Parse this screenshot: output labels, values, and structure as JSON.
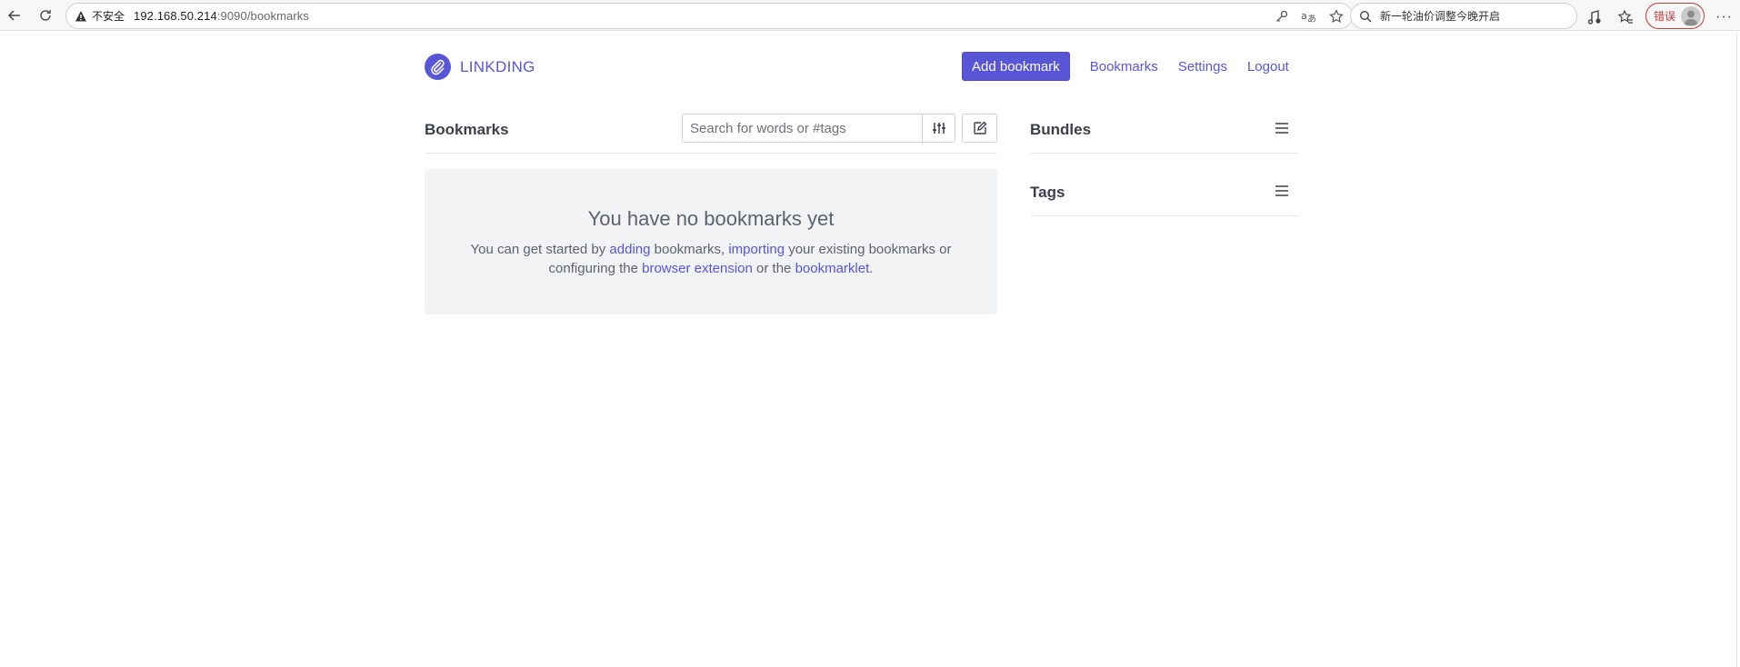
{
  "browser": {
    "insecure_label": "不安全",
    "url_host": "192.168.50.214",
    "url_rest": ":9090/bookmarks",
    "search_text": "新一轮油价调整今晚开启",
    "error_label": "错误",
    "more_label": "···"
  },
  "app": {
    "brand_name": "LINKDING",
    "nav": {
      "add_bookmark": "Add bookmark",
      "bookmarks": "Bookmarks",
      "settings": "Settings",
      "logout": "Logout"
    }
  },
  "main": {
    "title": "Bookmarks",
    "search_placeholder": "Search for words or #tags",
    "empty": {
      "title": "You have no bookmarks yet",
      "text_1": "You can get started by ",
      "link_adding": "adding",
      "text_2": " bookmarks, ",
      "link_importing": "importing",
      "text_3": " your existing bookmarks or configuring the ",
      "link_extension": "browser extension",
      "text_4": " or the ",
      "link_bookmarklet": "bookmarklet",
      "text_5": "."
    }
  },
  "sidebar": {
    "bundles_title": "Bundles",
    "tags_title": "Tags"
  },
  "colors": {
    "accent": "#5856d6",
    "error": "#c23b3b",
    "empty_bg": "#f2f3f5"
  },
  "icons": {
    "back": "arrow-left-icon",
    "reload": "reload-icon",
    "warning": "warning-triangle-icon",
    "key": "key-icon",
    "translate": "translate-icon",
    "star": "star-icon",
    "search": "search-icon",
    "music": "music-note-icon",
    "favorites": "favorites-icon",
    "avatar": "user-avatar-icon",
    "logo": "paperclip-icon",
    "filter": "sliders-icon",
    "edit": "pencil-icon",
    "menu": "hamburger-icon"
  }
}
